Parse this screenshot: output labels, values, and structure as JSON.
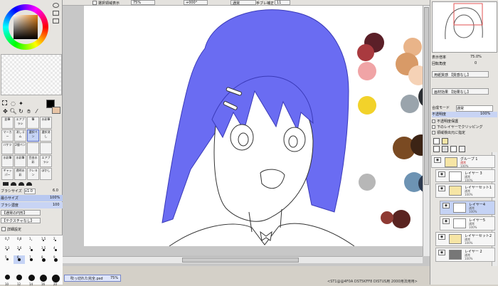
{
  "toolbar": {
    "selection_show_label": "選択領域表示",
    "zoom_value": "75%",
    "angle_value": "+000°",
    "blend_mode_value": "通常",
    "stabilizer_label": "手ブレ補正",
    "stabilizer_value": "11"
  },
  "left_panel": {
    "tools_row1": [
      "鉛筆",
      "エアブラシ",
      "筆",
      "水彩筆"
    ],
    "tools_row2": [
      "マーカー",
      "消しゴム",
      "選択ペン",
      "選択消し"
    ],
    "tools_row3": [
      "バケツ",
      "2値ペン",
      "",
      ""
    ],
    "tools_row4": [
      "水彩筆",
      "水彩筆",
      "目由水彩",
      "エアブラシ"
    ],
    "tools_row5": [
      "ギャッパー",
      "透明水彩",
      "クレヨン",
      "ぼかし"
    ],
    "brush_size_label": "ブラシサイズ",
    "brush_size_mult": "x1.0",
    "brush_size_value": "6.0",
    "min_size_label": "最小サイズ",
    "min_size_value": "100%",
    "brush_density_label": "ブラシ濃度",
    "brush_density_value": "100",
    "shape_select": "【通常の円形】",
    "texture_select": "【テクスチャなし】",
    "detail_label": "詳細設定",
    "size_rows": [
      [
        "0.7",
        "0.8",
        "1",
        "1.5",
        "2"
      ],
      [
        "2.3",
        "2.6",
        "3",
        "3.5",
        "4"
      ],
      [
        "5",
        "6",
        "7",
        "8",
        "9"
      ],
      [
        "",
        "",
        "",
        "",
        ""
      ],
      [
        "10",
        "12",
        "14",
        "16",
        "20"
      ]
    ]
  },
  "document_tab": {
    "name": "吹っ切れた完全.psd",
    "zoom": "75%"
  },
  "right_panel": {
    "zoom_label": "表示倍率",
    "zoom_value": "75.0%",
    "rotation_label": "回転角度",
    "rotation_value": "0",
    "paper_texture": "用紙質感 【質感なし】",
    "paper_effect": "画材効果 【効果なし】",
    "blend_mode_label": "合成モード",
    "blend_mode_value": "通常",
    "opacity_label": "不透明度",
    "opacity_value": "100%",
    "protect_opacity": "不透明度保護",
    "clip_lower": "下のレイヤーでクリッピング",
    "selection_source": "領域検出元に指定",
    "layers": [
      {
        "name": "グループ 1",
        "mode": "通常",
        "pct": "100%"
      },
      {
        "name": "レイヤー 3",
        "mode": "通常",
        "pct": "100%"
      },
      {
        "name": "レイヤーセット1",
        "mode": "通常",
        "pct": "100%"
      },
      {
        "name": "レイヤー4",
        "mode": "通常",
        "pct": "100%"
      },
      {
        "name": "レイヤー5",
        "mode": "通常",
        "pct": "100%"
      },
      {
        "name": "レイヤーセット2",
        "mode": "通常",
        "pct": "100%"
      },
      {
        "name": "レイヤー 2",
        "mode": "通常",
        "pct": "100%"
      }
    ]
  },
  "status_bar": {
    "text": "<ST1@@4F0A DST5KFF8 DISTUS用 2000用法用用>"
  },
  "colors": {
    "hair": "#6a6cf2",
    "accent_select": "#c5d3f5"
  }
}
